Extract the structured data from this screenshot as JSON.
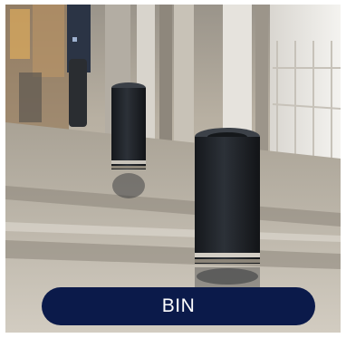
{
  "photo": {
    "subject": "trash-bin-row-photo",
    "colors": {
      "floor": "#b9b2a3",
      "bin": "#1e2227",
      "pill": "#0b1a4a",
      "pill_text": "#ffffff"
    }
  },
  "label": {
    "text": "BIN"
  }
}
